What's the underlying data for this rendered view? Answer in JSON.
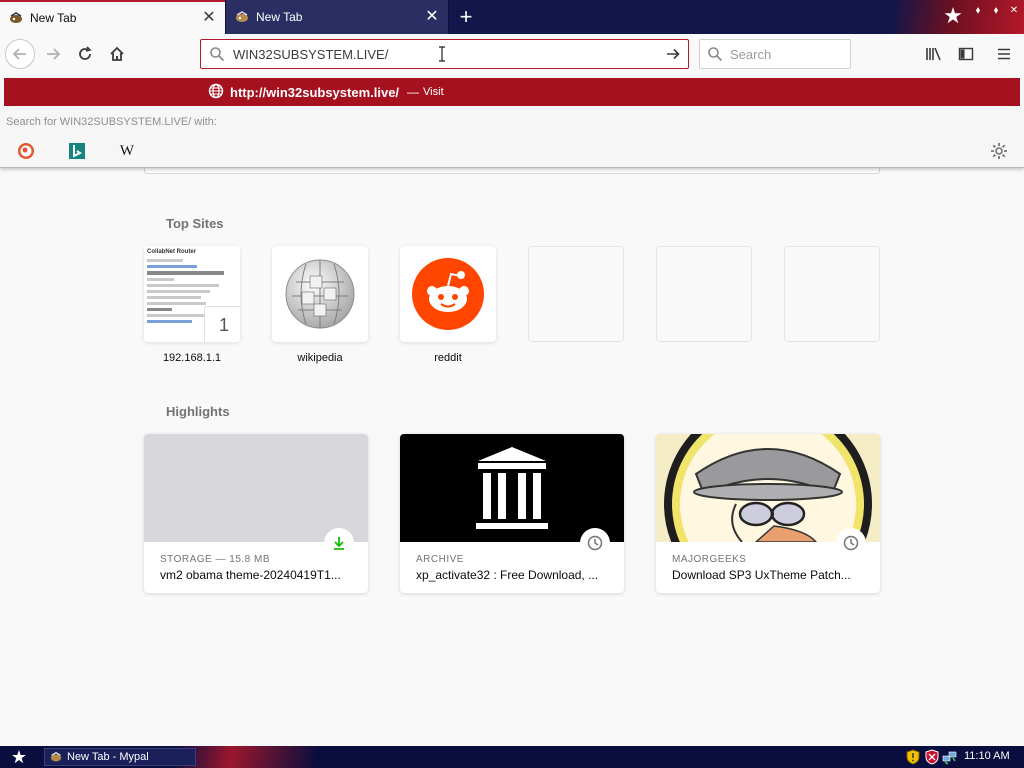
{
  "tabs": [
    {
      "title": "New Tab",
      "close": "✕"
    },
    {
      "title": "New Tab",
      "close": "✕"
    }
  ],
  "newtab_symbol": "+",
  "window_buttons": [
    "⬧",
    "⬧",
    "✕"
  ],
  "toolbar": {
    "url_value": "WIN32SUBSYSTEM.LIVE/",
    "search_placeholder": "Search"
  },
  "popup": {
    "visit_url": "http://win32subsystem.live/",
    "visit_separator": "—",
    "visit_action": "Visit",
    "search_with": "Search for WIN32SUBSYSTEM.LIVE/ with:",
    "engine_wikipedia_glyph": "W"
  },
  "top_sites": {
    "title": "Top Sites",
    "tiles": [
      {
        "label": "192.168.1.1",
        "thumb_title": "CollabNet Router",
        "pin": "1"
      },
      {
        "label": "wikipedia"
      },
      {
        "label": "reddit"
      },
      {
        "label": ""
      },
      {
        "label": ""
      },
      {
        "label": ""
      }
    ]
  },
  "highlights": {
    "title": "Highlights",
    "cards": [
      {
        "context": "STORAGE — 15.8 MB",
        "title": "vm2 obama theme-20240419T1...",
        "badge": "download-icon"
      },
      {
        "context": "ARCHIVE",
        "title": "xp_activate32 : Free Download, ...",
        "badge": "clock-icon"
      },
      {
        "context": "MAJORGEEKS",
        "title": "Download SP3 UxTheme Patch...",
        "badge": "clock-icon"
      }
    ]
  },
  "taskbar": {
    "start_glyph": "★",
    "item_label": "New Tab - Mypal",
    "clock": "11:10 AM"
  },
  "colors": {
    "accent_red": "#a5111f",
    "tabstrip_navy": "#12164a",
    "reddit_orange": "#ff4500"
  }
}
